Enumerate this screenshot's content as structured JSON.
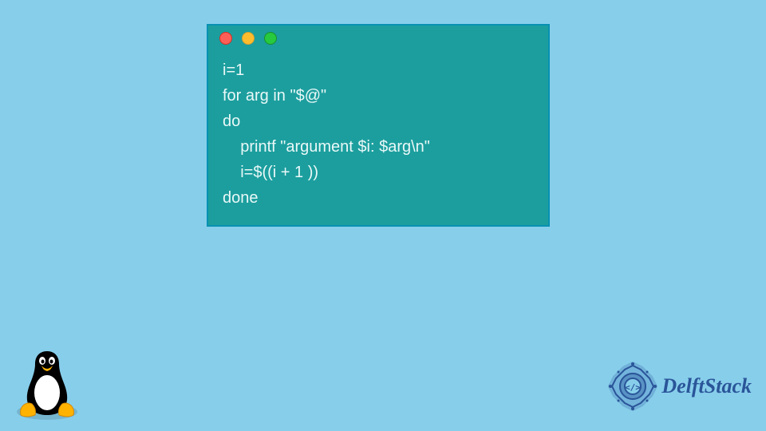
{
  "code": {
    "lines": [
      "i=1",
      "for arg in \"$@\"",
      "do",
      "    printf \"argument $i: $arg\\n\"",
      "    i=$((i + 1 ))",
      "done"
    ]
  },
  "brand": {
    "name": "DelftStack"
  },
  "colors": {
    "background": "#87CEEB",
    "terminal": "#1C9E9E",
    "brand": "#2a5599"
  }
}
